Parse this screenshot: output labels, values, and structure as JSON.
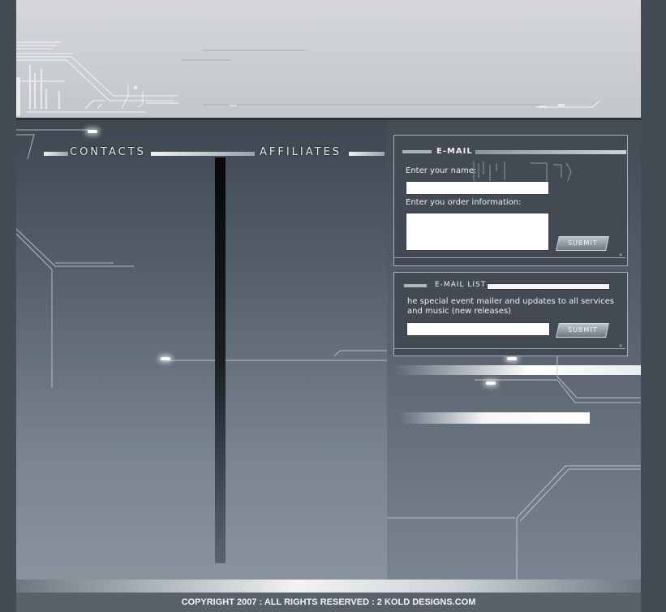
{
  "nav": {
    "contacts": "CONTACTS",
    "affiliates": "AFFILIATES"
  },
  "email_form": {
    "title": "E-MAIL",
    "name_label": "Enter your name:",
    "name_value": "",
    "order_label": "Enter you order information:",
    "order_value": "",
    "submit_label": "SUBMIT",
    "more_icon": "double-chevron-right-icon"
  },
  "email_list": {
    "title": "E-MAIL  LIST",
    "description": "he special event mailer and updates to all services and music (new releases)",
    "email_value": "",
    "submit_label": "SUBMIT",
    "more_icon": "double-chevron-right-icon"
  },
  "footer": {
    "copyright": "COPYRIGHT 2007  : ALL RIGHTS RESERVED   :  2 KOLD DESIGNS.COM"
  },
  "colors": {
    "outer_background": "#434c55",
    "header": "#cfd1d4",
    "panel_dark": "#3f4751",
    "accent_light": "#f2f2f2"
  }
}
